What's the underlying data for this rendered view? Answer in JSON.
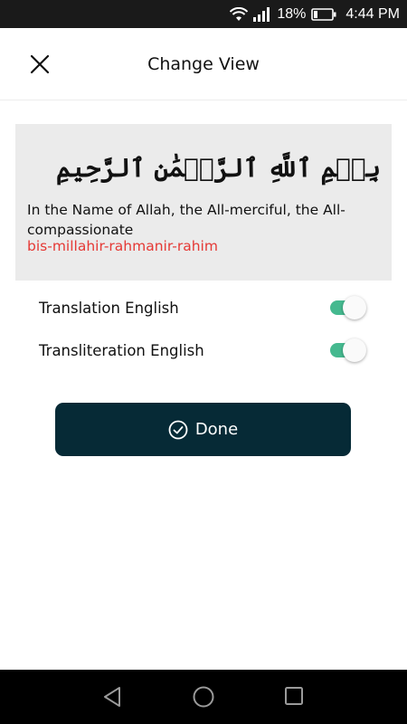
{
  "status_bar": {
    "battery_percent": "18%",
    "time": "4:44 PM",
    "icons": [
      "wifi-icon",
      "signal-icon",
      "battery-icon"
    ]
  },
  "header": {
    "title": "Change View",
    "close_icon": "close-icon"
  },
  "preview": {
    "arabic": "بِسۡمِ ٱللَّهِ ٱلرَّحۡمَٰنِ ٱلرَّحِيمِ",
    "translation": "In the Name of Allah, the All-merciful, the All-compassionate",
    "transliteration": "bis-millahir-rahmanir-rahim"
  },
  "toggles": [
    {
      "label": "Translation English",
      "on": true
    },
    {
      "label": "Transliteration English",
      "on": true
    }
  ],
  "done_button": {
    "label": "Done",
    "icon": "check-circle-icon"
  },
  "nav_bar": {
    "icons": [
      "back-icon",
      "home-icon",
      "recents-icon"
    ]
  },
  "colors": {
    "accent": "#45b98f",
    "button_bg": "#062a36",
    "transliteration": "#e53935",
    "card_bg": "#ebebeb"
  }
}
